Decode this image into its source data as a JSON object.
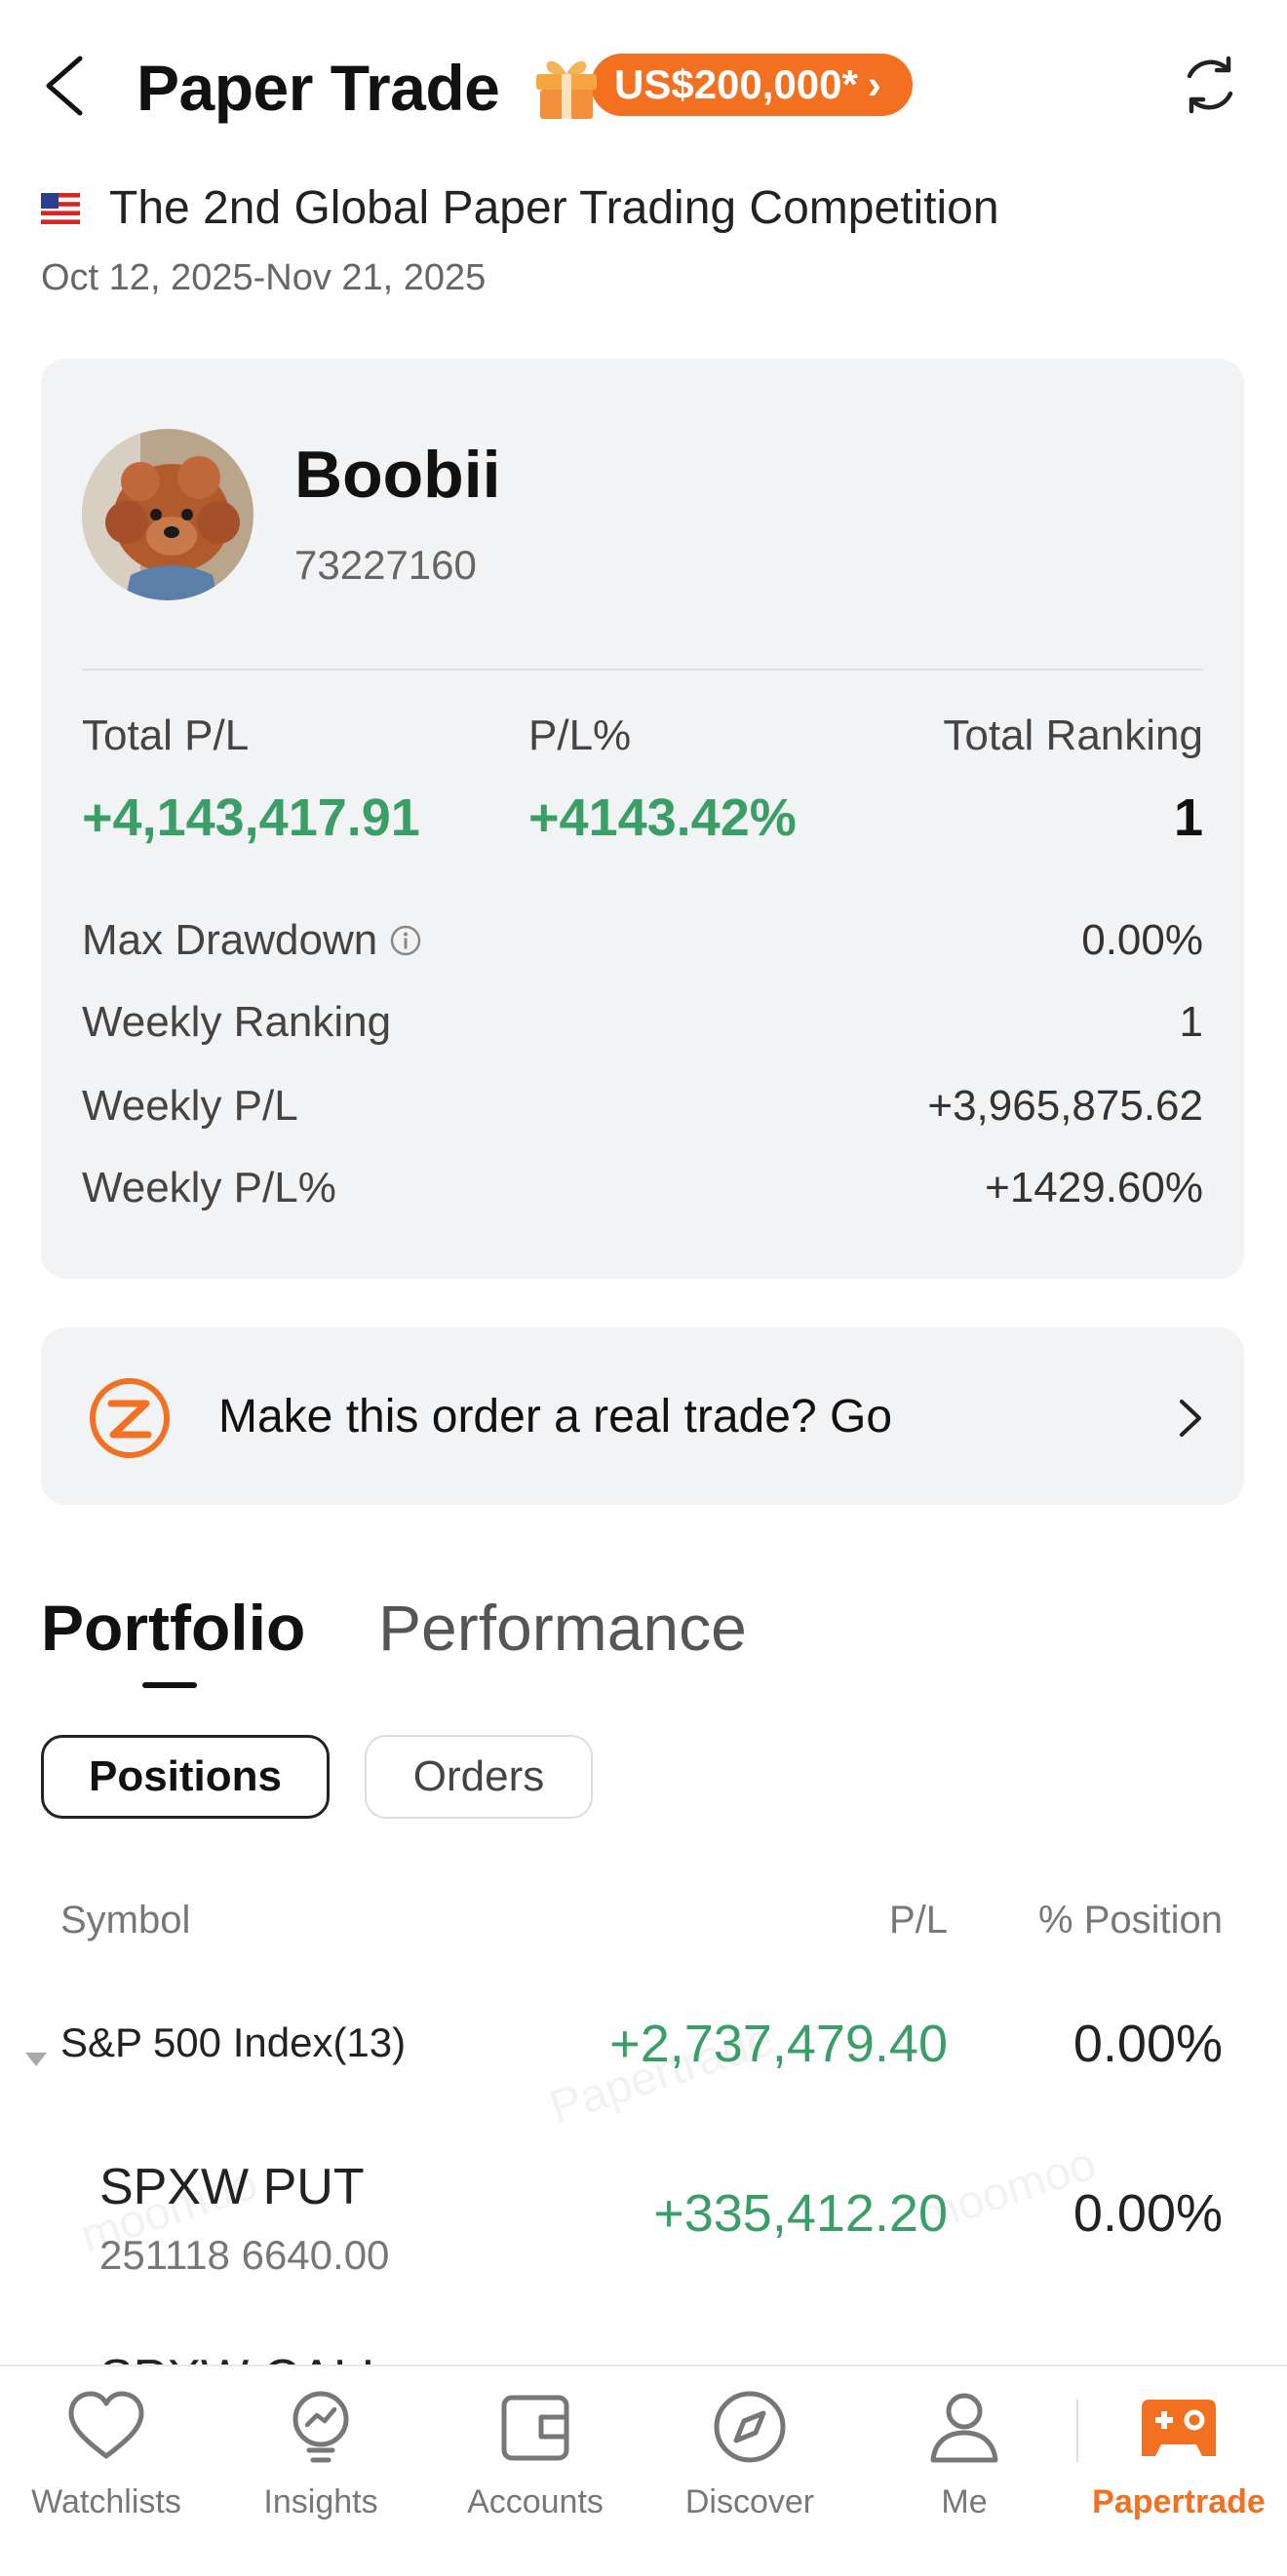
{
  "header": {
    "title": "Paper Trade",
    "promo_label": "US$200,000*",
    "promo_chevron": "›"
  },
  "competition": {
    "title": "The 2nd Global Paper Trading Competition",
    "dates": "Oct 12, 2025-Nov 21, 2025"
  },
  "profile": {
    "username": "Boobii",
    "user_id": "73227160",
    "total_pl_label": "Total P/L",
    "total_pl_value": "+4,143,417.91",
    "pl_pct_label": "P/L%",
    "pl_pct_value": "+4143.42%",
    "total_ranking_label": "Total Ranking",
    "total_ranking_value": "1",
    "max_drawdown_label": "Max Drawdown",
    "max_drawdown_value": "0.00%",
    "weekly_ranking_label": "Weekly Ranking",
    "weekly_ranking_value": "1",
    "weekly_pl_label": "Weekly P/L",
    "weekly_pl_value": "+3,965,875.62",
    "weekly_pl_pct_label": "Weekly P/L%",
    "weekly_pl_pct_value": "+1429.60%"
  },
  "banner": {
    "text": "Make this order a real trade? Go"
  },
  "tabs": {
    "portfolio": "Portfolio",
    "performance": "Performance"
  },
  "subtabs": {
    "positions": "Positions",
    "orders": "Orders"
  },
  "table": {
    "headers": {
      "symbol": "Symbol",
      "pl": "P/L",
      "position": "% Position"
    },
    "rows": [
      {
        "name": "S&P 500 Index(13)",
        "pl": "+2,737,479.40",
        "position": "0.00%"
      },
      {
        "name": "SPXW PUT",
        "sub": "251118 6640.00",
        "pl": "+335,412.20",
        "position": "0.00%"
      },
      {
        "name": "SPXW CALL"
      }
    ]
  },
  "watermarks": [
    "Papertrade",
    "moomoo",
    "moomoo"
  ],
  "nav": {
    "items": [
      {
        "label": "Watchlists",
        "icon": "heart-icon"
      },
      {
        "label": "Insights",
        "icon": "lightbulb-icon"
      },
      {
        "label": "Accounts",
        "icon": "wallet-icon"
      },
      {
        "label": "Discover",
        "icon": "compass-icon"
      },
      {
        "label": "Me",
        "icon": "person-icon"
      },
      {
        "label": "Papertrade",
        "icon": "gamepad-icon"
      }
    ],
    "active_color": "#f2701f"
  },
  "colors": {
    "accent": "#f2701f",
    "positive": "#3a9f66"
  }
}
